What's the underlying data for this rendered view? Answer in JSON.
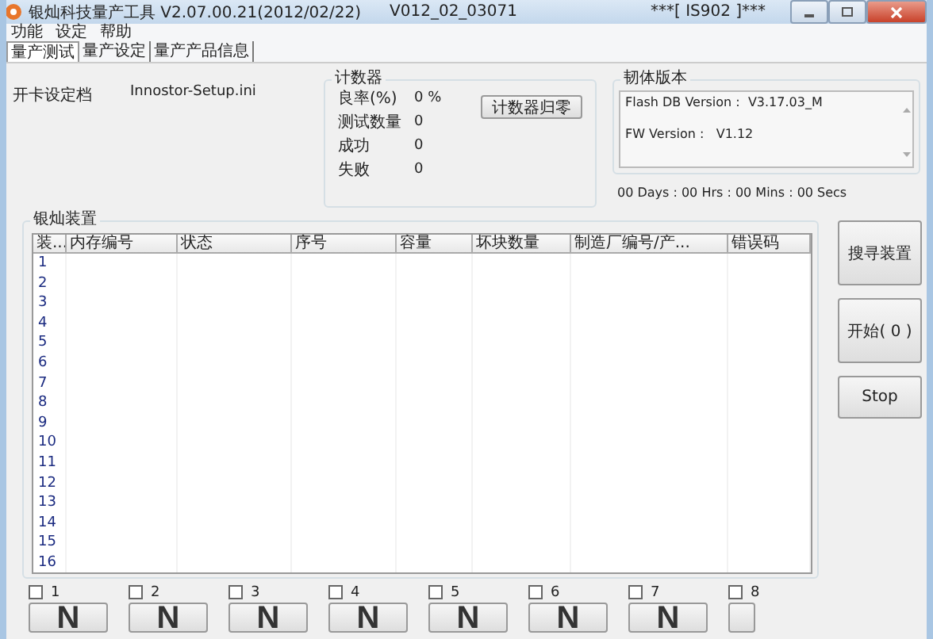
{
  "window": {
    "title": "银灿科技量产工具 V2.07.00.21(2012/02/22)",
    "version": "V012_02_03071",
    "model": "***[ IS902 ]***"
  },
  "menu": [
    "功能",
    "设定",
    "帮助"
  ],
  "tabs": [
    {
      "label": "量产测试",
      "selected": true
    },
    {
      "label": "量产设定",
      "selected": false
    },
    {
      "label": "量产产品信息",
      "selected": false
    }
  ],
  "settings_file": {
    "label": "开卡设定档",
    "value": "Innostor-Setup.ini"
  },
  "counter": {
    "title": "计数器",
    "reset_button": "计数器归零",
    "rows": [
      {
        "label": "良率(%)",
        "value": "0 %"
      },
      {
        "label": "测试数量",
        "value": "0"
      },
      {
        "label": "成功",
        "value": "0"
      },
      {
        "label": "失败",
        "value": "0"
      }
    ]
  },
  "firmware": {
    "title": "韧体版本",
    "lines": [
      "Flash DB Version :  V3.17.03_M",
      "FW Version :   V1.12"
    ]
  },
  "timer": "00 Days : 00 Hrs : 00 Mins : 00 Secs",
  "devices": {
    "title": "银灿装置",
    "columns": [
      "装...",
      "内存编号",
      "状态",
      "序号",
      "容量",
      "坏块数量",
      "制造厂编号/产...",
      "错误码"
    ],
    "rows": [
      "1",
      "2",
      "3",
      "4",
      "5",
      "6",
      "7",
      "8",
      "9",
      "10",
      "11",
      "12",
      "13",
      "14",
      "15",
      "16"
    ]
  },
  "buttons": [
    "搜寻装置",
    "开始( 0 )",
    "Stop"
  ],
  "slots": [
    {
      "label": "1",
      "checked": false,
      "button": "N"
    },
    {
      "label": "2",
      "checked": false,
      "button": "N"
    },
    {
      "label": "3",
      "checked": false,
      "button": "N"
    },
    {
      "label": "4",
      "checked": false,
      "button": "N"
    },
    {
      "label": "5",
      "checked": false,
      "button": "N"
    },
    {
      "label": "6",
      "checked": false,
      "button": "N"
    },
    {
      "label": "7",
      "checked": false,
      "button": "N"
    },
    {
      "label": "8",
      "checked": false
    }
  ]
}
